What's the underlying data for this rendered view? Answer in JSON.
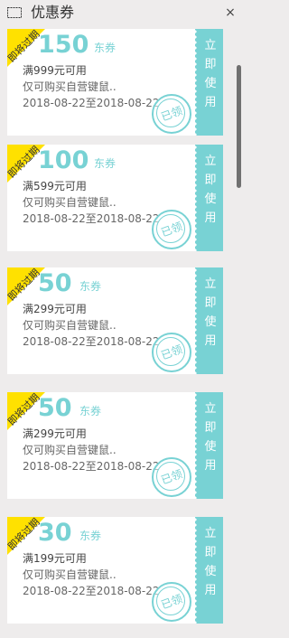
{
  "header": {
    "title": "优惠券",
    "close": "×"
  },
  "coupons": [
    {
      "badge": "即将过期",
      "amount": "150",
      "unit": "东券",
      "condition": "满999元可用",
      "scope": "仅可购买自营键鼠..",
      "date_range": "2018-08-22至2018-08-22",
      "stamp": "已领",
      "action": "立即使用"
    },
    {
      "badge": "即将过期",
      "amount": "100",
      "unit": "东券",
      "condition": "满599元可用",
      "scope": "仅可购买自营键鼠..",
      "date_range": "2018-08-22至2018-08-22",
      "stamp": "已领",
      "action": "立即使用"
    },
    {
      "badge": "即将过期",
      "amount": "50",
      "unit": "东券",
      "condition": "满299元可用",
      "scope": "仅可购买自营键鼠..",
      "date_range": "2018-08-22至2018-08-22",
      "stamp": "已领",
      "action": "立即使用"
    },
    {
      "badge": "即将过期",
      "amount": "50",
      "unit": "东券",
      "condition": "满299元可用",
      "scope": "仅可购买自营键鼠..",
      "date_range": "2018-08-22至2018-08-22",
      "stamp": "已领",
      "action": "立即使用"
    },
    {
      "badge": "即将过期",
      "amount": "30",
      "unit": "东券",
      "condition": "满199元可用",
      "scope": "仅可购买自营键鼠..",
      "date_range": "2018-08-22至2018-08-22",
      "stamp": "已领",
      "action": "立即使用"
    }
  ],
  "colors": {
    "accent": "#78d2d4",
    "badge": "#ffe100",
    "background": "#eeecec"
  }
}
